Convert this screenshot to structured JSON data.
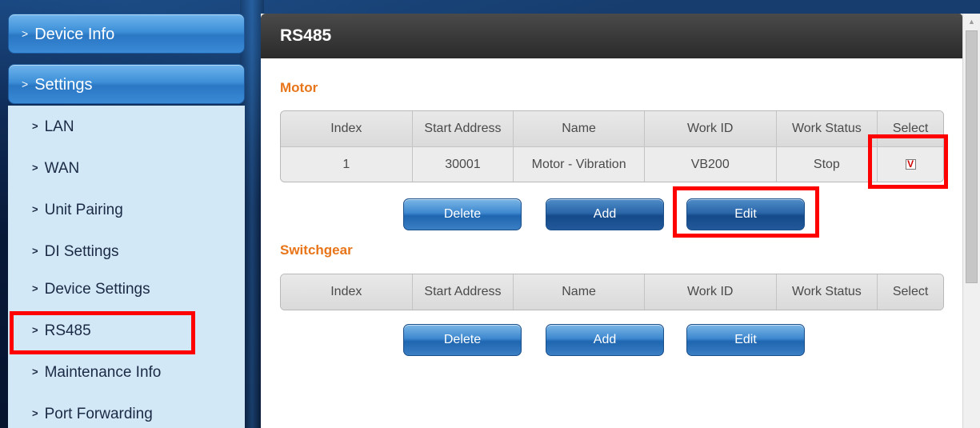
{
  "sidebar": {
    "device_info": "Device Info",
    "settings": "Settings",
    "items": [
      {
        "label": "LAN"
      },
      {
        "label": "WAN"
      },
      {
        "label": "Unit Pairing"
      },
      {
        "label": "DI Settings"
      },
      {
        "label": "Device Settings"
      },
      {
        "label": "RS485"
      },
      {
        "label": "Maintenance Info"
      },
      {
        "label": "Port Forwarding"
      }
    ]
  },
  "panel": {
    "title": "RS485",
    "motor": {
      "title": "Motor",
      "headers": [
        "Index",
        "Start Address",
        "Name",
        "Work ID",
        "Work Status",
        "Select"
      ],
      "rows": [
        {
          "index": "1",
          "start_address": "30001",
          "name": "Motor - Vibration",
          "work_id": "VB200",
          "work_status": "Stop",
          "selected_mark": "V"
        }
      ],
      "buttons": {
        "delete": "Delete",
        "add": "Add",
        "edit": "Edit"
      }
    },
    "switchgear": {
      "title": "Switchgear",
      "headers": [
        "Index",
        "Start Address",
        "Name",
        "Work ID",
        "Work Status",
        "Select"
      ],
      "buttons": {
        "delete": "Delete",
        "add": "Add",
        "edit": "Edit"
      }
    }
  },
  "colors": {
    "highlight": "#ff0000",
    "section_title": "#e8751a",
    "button_blue": "#2a77c4"
  }
}
